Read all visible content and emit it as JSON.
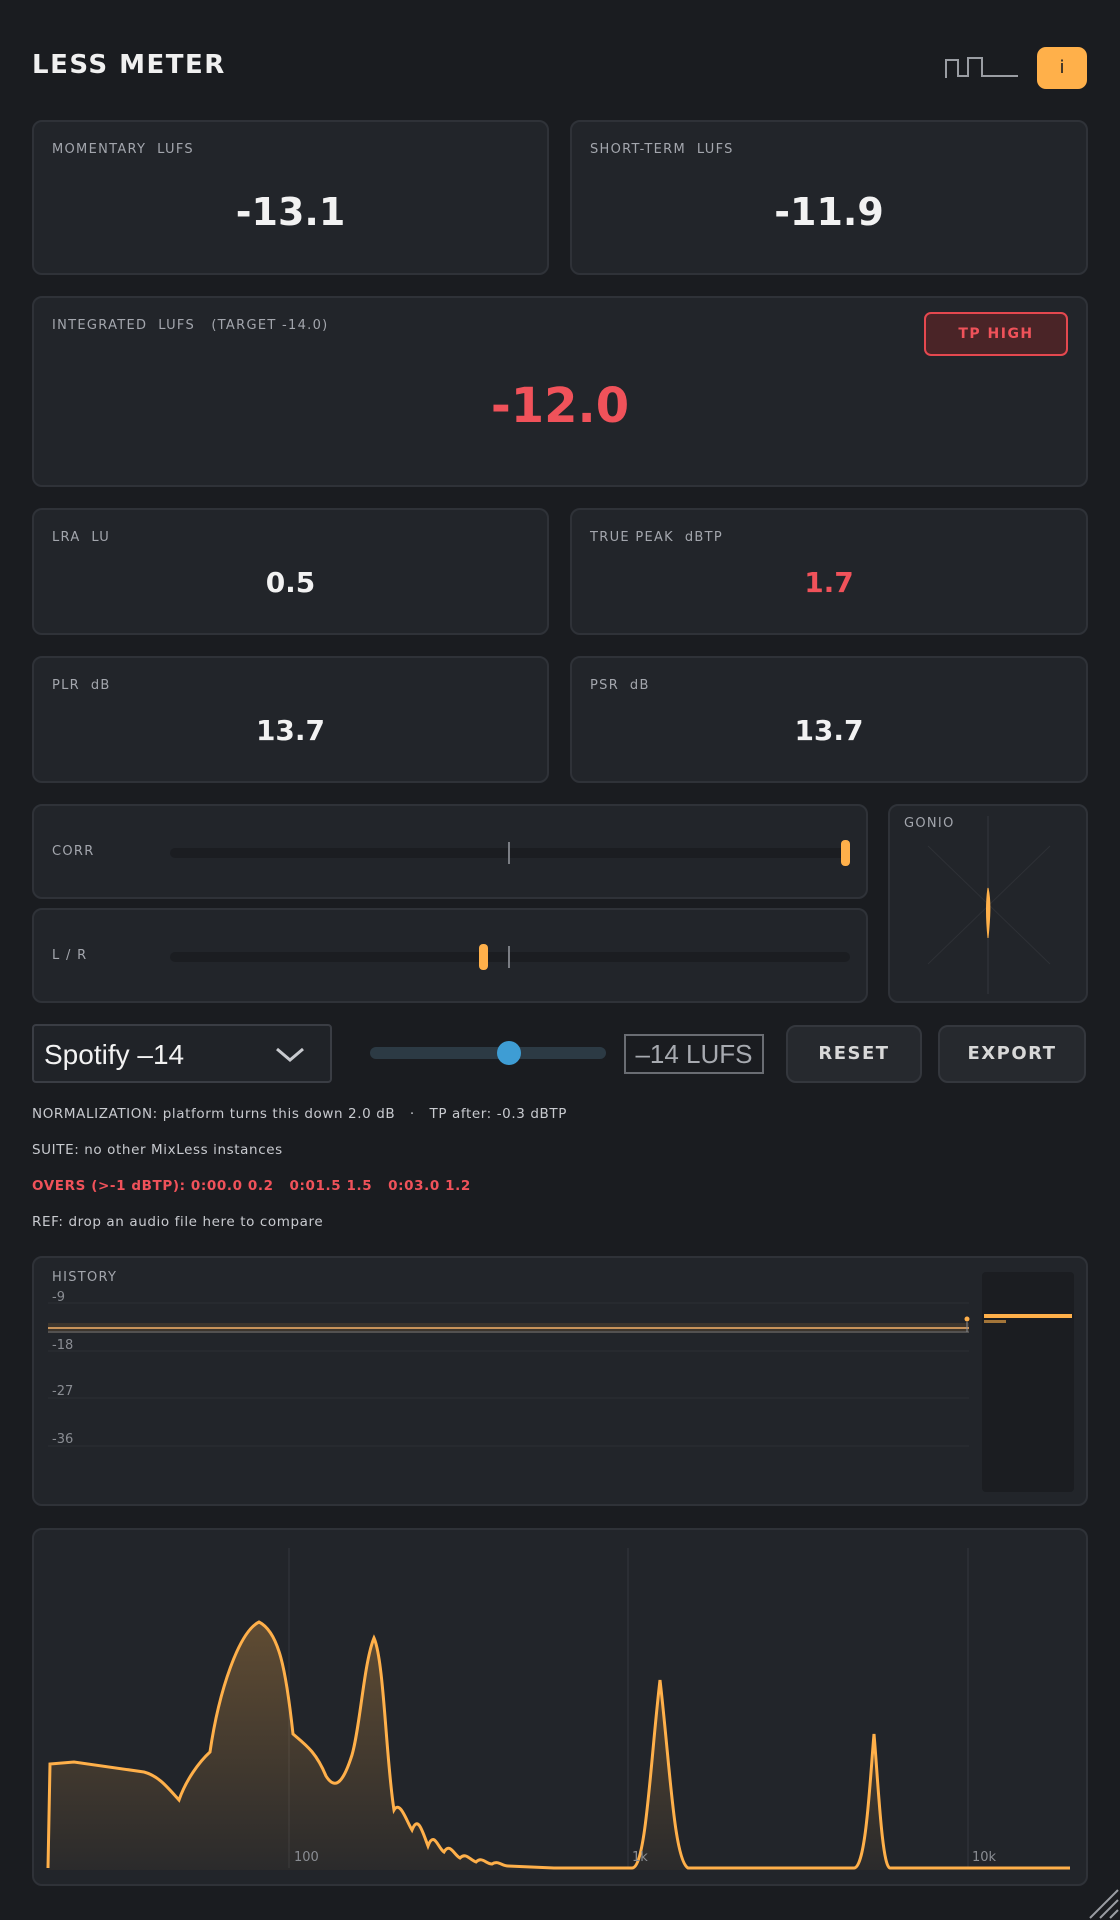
{
  "app": {
    "title": "LESS METER",
    "info_label": "i"
  },
  "cards": {
    "momentary": {
      "label": "MOMENTARY  LUFS",
      "value": "-13.1"
    },
    "short_term": {
      "label": "SHORT-TERM  LUFS",
      "value": "-11.9"
    },
    "integrated": {
      "label": "INTEGRATED  LUFS   (TARGET -14.0)",
      "value": "-12.0",
      "warning_button": "TP HIGH"
    },
    "lra": {
      "label": "LRA  LU",
      "value": "0.5"
    },
    "true_peak": {
      "label": "TRUE PEAK  dBTP",
      "value": "1.7"
    },
    "plr": {
      "label": "PLR  dB",
      "value": "13.7"
    },
    "psr": {
      "label": "PSR  dB",
      "value": "13.7"
    }
  },
  "meters": {
    "corr": {
      "label": "CORR",
      "level": 1.0
    },
    "lr": {
      "label": "L / R",
      "level": 0.46
    },
    "gonio": {
      "label": "GONIO"
    }
  },
  "controls": {
    "platform": "Spotify –14",
    "slider_level": 0.6,
    "lufs_target": "–14 LUFS",
    "reset": "RESET",
    "export": "EXPORT"
  },
  "info": {
    "normalization": "NORMALIZATION: platform turns this down 2.0 dB   ·   TP after: -0.3 dBTP",
    "suite": "SUITE: no other MixLess instances",
    "overs": "OVERS (>-1 dBTP): 0:00.0 0.2   0:01.5 1.5   0:03.0 1.2",
    "ref": "REF: drop an audio file here to compare"
  },
  "history": {
    "label": "HISTORY",
    "ticks": [
      "-9",
      "-18",
      "-27",
      "-36"
    ]
  },
  "spectrum": {
    "ticks": [
      "100",
      "1k",
      "10k"
    ]
  },
  "colors": {
    "accent": "#ffb04a",
    "alert": "#f0525a",
    "slider": "#3e9dd4",
    "background": "#1a1c20",
    "panel": "#22252a"
  }
}
